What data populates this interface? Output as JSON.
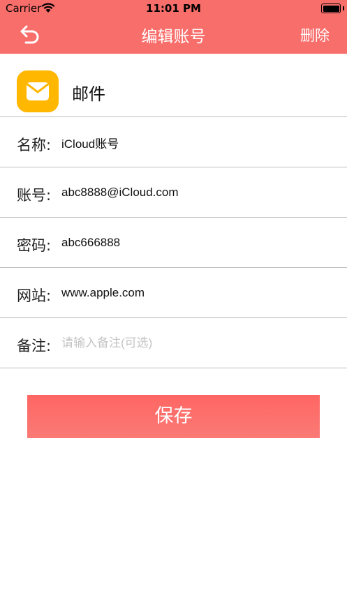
{
  "status_bar": {
    "carrier": "Carrier",
    "time": "11:01 PM"
  },
  "nav": {
    "title": "编辑账号",
    "delete_label": "删除",
    "back_icon": "undo-arrow-icon"
  },
  "app": {
    "name": "邮件",
    "icon": "mail-envelope-icon",
    "icon_color": "#ffb700"
  },
  "fields": [
    {
      "label": "名称:",
      "value": "iCloud账号",
      "placeholder": ""
    },
    {
      "label": "账号:",
      "value": "abc8888@iCloud.com",
      "placeholder": ""
    },
    {
      "label": "密码:",
      "value": "abc666888",
      "placeholder": ""
    },
    {
      "label": "网站:",
      "value": "www.apple.com",
      "placeholder": ""
    },
    {
      "label": "备注:",
      "value": "",
      "placeholder": "请输入备注(可选)"
    }
  ],
  "save_label": "保存",
  "colors": {
    "accent": "#f86e6b",
    "separator": "#bdbdbd"
  }
}
